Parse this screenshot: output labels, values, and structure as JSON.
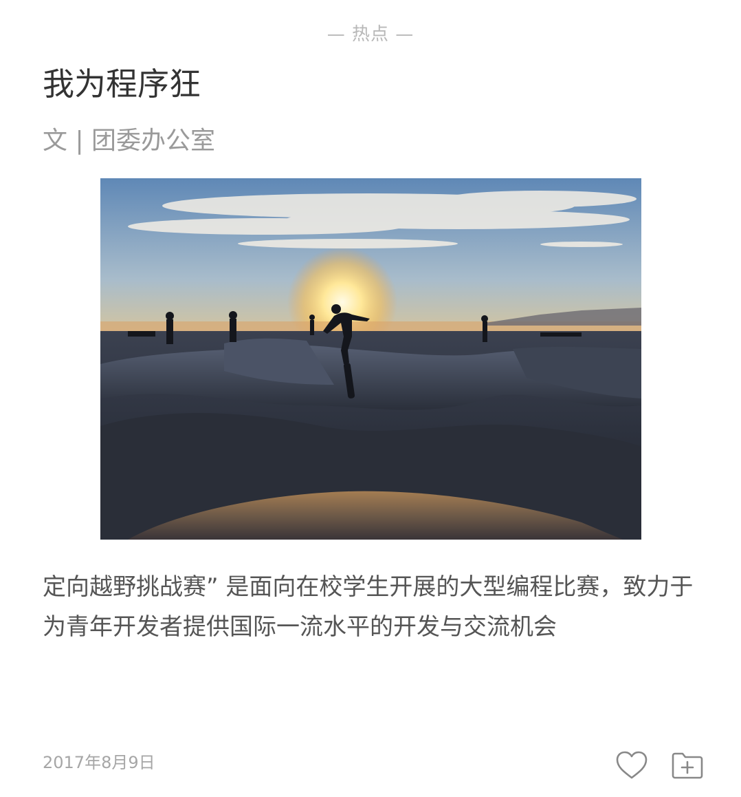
{
  "section": {
    "label": "— 热点 —"
  },
  "article": {
    "title": "我为程序狂",
    "author": "文 | 团委办公室",
    "image_alt": "skate-park-sunset-photo",
    "summary": "定向越野挑战赛” 是面向在校学生开展的大型编程比赛，致力于为青年开发者提供国际一流水平的开发与交流机会",
    "date": "2017年8月9日"
  },
  "actions": {
    "like_icon": "heart-icon",
    "collect_icon": "folder-add-icon"
  },
  "colors": {
    "title": "#333333",
    "muted": "#9a9a9a",
    "body": "#555555",
    "icon": "#888888"
  }
}
